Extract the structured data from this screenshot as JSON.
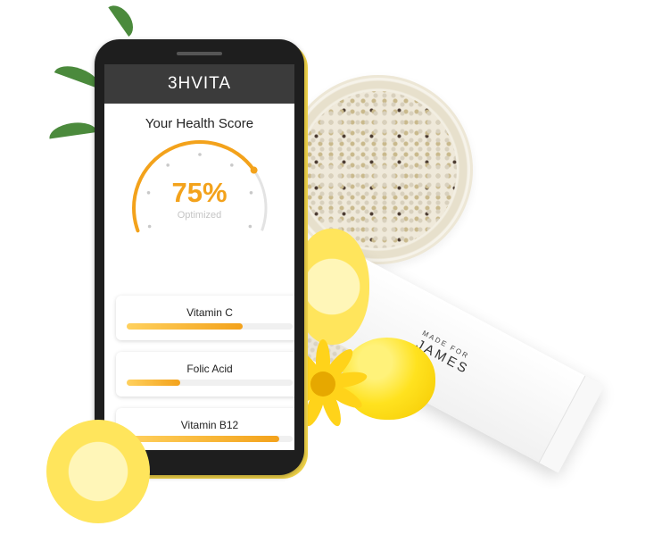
{
  "app": {
    "title": "3HVITA"
  },
  "score": {
    "heading": "Your Health Score",
    "value": "75%",
    "label": "Optimized",
    "percent": 75
  },
  "nutrients": [
    {
      "name": "Vitamin C",
      "level": 0.7
    },
    {
      "name": "Folic Acid",
      "level": 0.32
    },
    {
      "name": "Vitamin B12",
      "level": 0.92
    }
  ],
  "product": {
    "line1": "MADE FOR",
    "line2": "JAMES"
  },
  "colors": {
    "accent": "#f3a21b",
    "appbar": "#3b3b3b",
    "track": "#f0f0f0"
  }
}
